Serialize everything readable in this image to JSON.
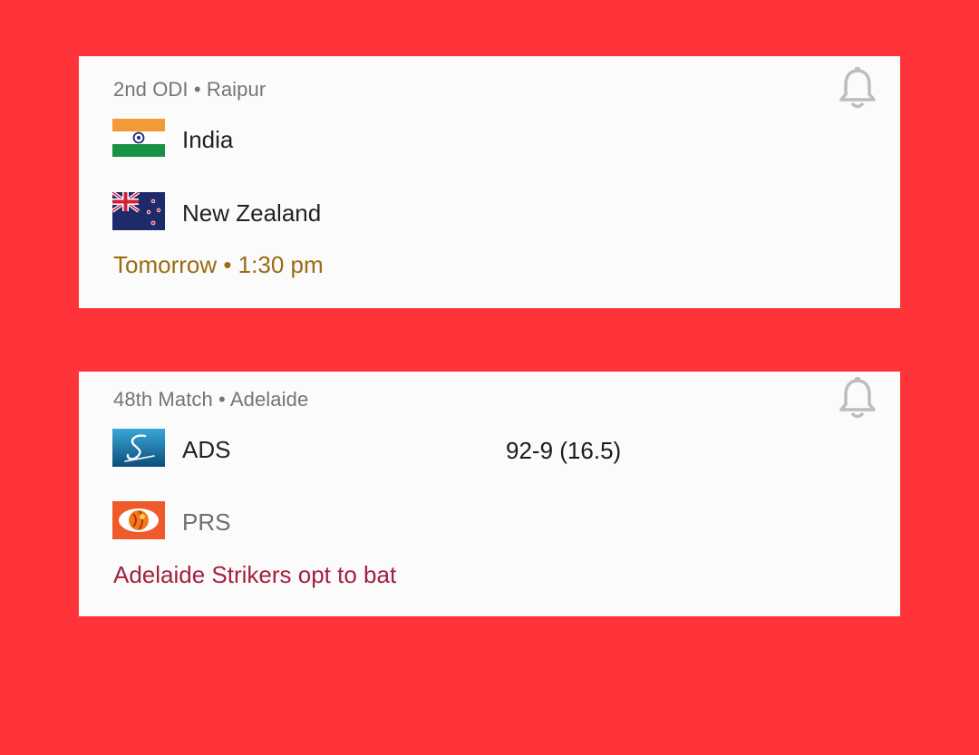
{
  "colors": {
    "background": "#fe343a",
    "card": "#fbfbfb",
    "time_status": "#9a6b11",
    "result_status": "#a3213f"
  },
  "matches": [
    {
      "title": "2nd ODI • Raipur",
      "bell_icon": "bell-icon",
      "teams": [
        {
          "name": "India",
          "flag": "india-flag-icon",
          "score": ""
        },
        {
          "name": "New Zealand",
          "flag": "new-zealand-flag-icon",
          "score": ""
        }
      ],
      "status": "Tomorrow • 1:30 pm"
    },
    {
      "title": "48th Match • Adelaide",
      "bell_icon": "bell-icon",
      "teams": [
        {
          "name": "ADS",
          "flag": "adelaide-strikers-logo-icon",
          "score": "92-9 (16.5)"
        },
        {
          "name": "PRS",
          "flag": "perth-scorchers-logo-icon",
          "score": ""
        }
      ],
      "status": "Adelaide Strikers opt to bat"
    }
  ]
}
